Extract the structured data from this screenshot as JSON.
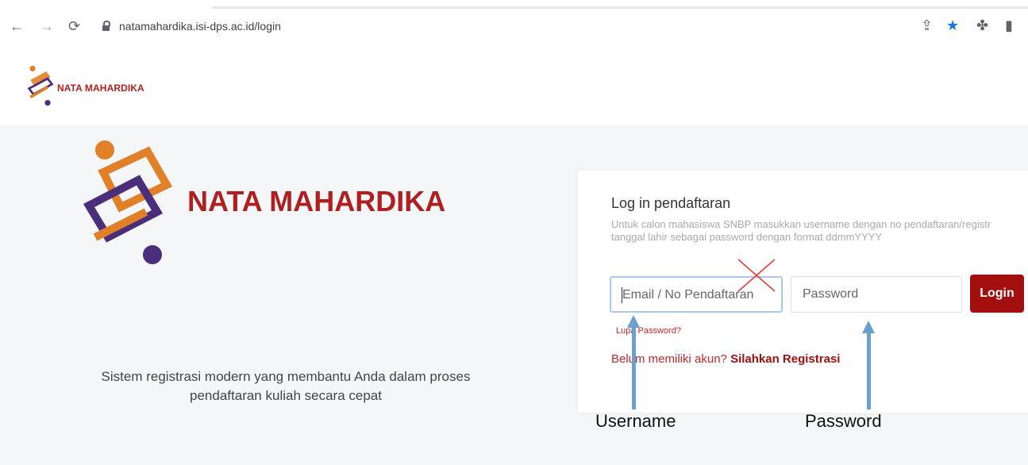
{
  "browser": {
    "back_icon": "arrow-left-icon",
    "forward_icon": "arrow-right-icon",
    "reload_icon": "reload-icon",
    "url": "natamahardika.isi-dps.ac.id/login",
    "share_icon": "share-icon",
    "bookmark_icon": "star-icon",
    "extensions_icon": "puzzle-icon",
    "sidepanel_icon": "side-panel-icon",
    "bookmark_color": "#1a73e8"
  },
  "header": {
    "brand": "NATA MAHARDIKA"
  },
  "hero": {
    "brand": "NATA MAHARDIKA",
    "tagline_line1": "Sistem registrasi modern yang membantu Anda dalam proses",
    "tagline_line2": "pendaftaran kuliah secara cepat"
  },
  "login": {
    "title": "Log in pendaftaran",
    "desc_line1": "Untuk calon mahasiswa SNBP masukkan username dengan no pendaftaran/registr",
    "desc_line2": "tanggal lahir sebagai password dengan format ddmmYYYY",
    "username_placeholder": "Email / No Pendaftaran",
    "password_placeholder": "Password",
    "login_label": "Login",
    "forgot_label": "Lupa Password?",
    "register_prefix": "Belum memiliki akun?",
    "register_link": "Silahkan Registrasi"
  },
  "annotations": {
    "username_label": "Username",
    "password_label": "Password",
    "arrow_color": "#6aa0d0",
    "x_color": "#e53935"
  },
  "colors": {
    "brand_red": "#b01f1f",
    "button_red": "#a30f0f",
    "logo_purple": "#4a2e7a",
    "logo_orange": "#e0812a"
  }
}
